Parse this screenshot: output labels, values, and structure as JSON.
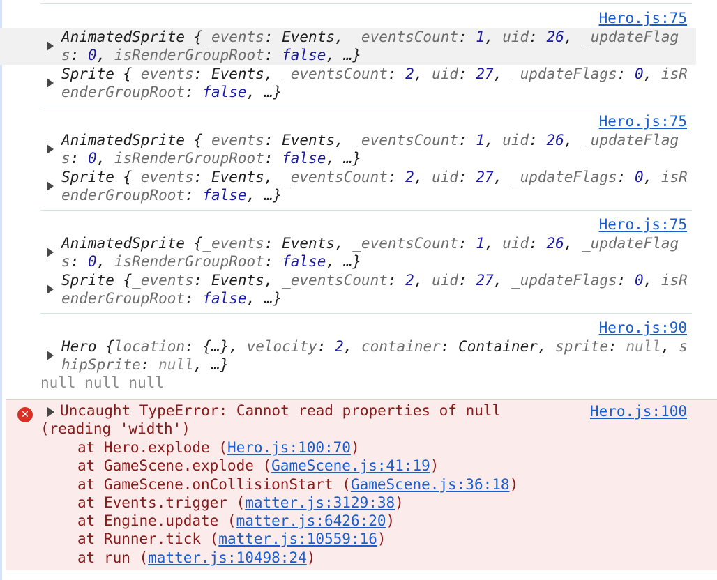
{
  "src_links": {
    "hero75": "Hero.js:75",
    "hero90": "Hero.js:90",
    "hero100": "Hero.js:100"
  },
  "animated_sprite": {
    "type": "AnimatedSprite",
    "events_key": "_events",
    "events_val": "Events",
    "count_key": "_eventsCount",
    "count_val": "1",
    "uid_key": "uid",
    "uid_val": "26",
    "flags_key": "_updateFlags",
    "flags_val": "0",
    "root_key": "isRenderGroupRoot",
    "root_val": "false",
    "ellipsis": "…"
  },
  "sprite": {
    "type": "Sprite",
    "events_key": "_events",
    "events_val": "Events",
    "count_key": "_eventsCount",
    "count_val": "2",
    "uid_key": "uid",
    "uid_val": "27",
    "flags_key": "_updateFlags",
    "flags_val": "0",
    "root_key": "isRenderGroupRoot",
    "root_val": "false",
    "ellipsis": "…"
  },
  "hero": {
    "type": "Hero",
    "location_key": "location",
    "location_val": "{…}",
    "velocity_key": "velocity",
    "velocity_val": "2",
    "container_key": "container",
    "container_val": "Container",
    "sprite_key": "sprite",
    "sprite_val": "null",
    "ship_key": "shipSprite",
    "ship_val": "null",
    "ellipsis": "…"
  },
  "null_line": "null null null",
  "error": {
    "message": "Uncaught TypeError: Cannot read properties of null (reading 'width')",
    "source": "Hero.js:100",
    "frames": [
      {
        "fn": "Hero.explode",
        "loc": "Hero.js:100:70"
      },
      {
        "fn": "GameScene.explode",
        "loc": "GameScene.js:41:19"
      },
      {
        "fn": "GameScene.onCollisionStart",
        "loc": "GameScene.js:36:18"
      },
      {
        "fn": "Events.trigger",
        "loc": "matter.js:3129:38"
      },
      {
        "fn": "Engine.update",
        "loc": "matter.js:6426:20"
      },
      {
        "fn": "Runner.tick",
        "loc": "matter.js:10559:16"
      },
      {
        "fn": "run",
        "loc": "matter.js:10498:24"
      }
    ]
  },
  "colors": {
    "link": "#1a5fd0",
    "error_bg": "#fcebeb",
    "error_text": "#8b1a1a",
    "error_icon": "#d93025"
  }
}
